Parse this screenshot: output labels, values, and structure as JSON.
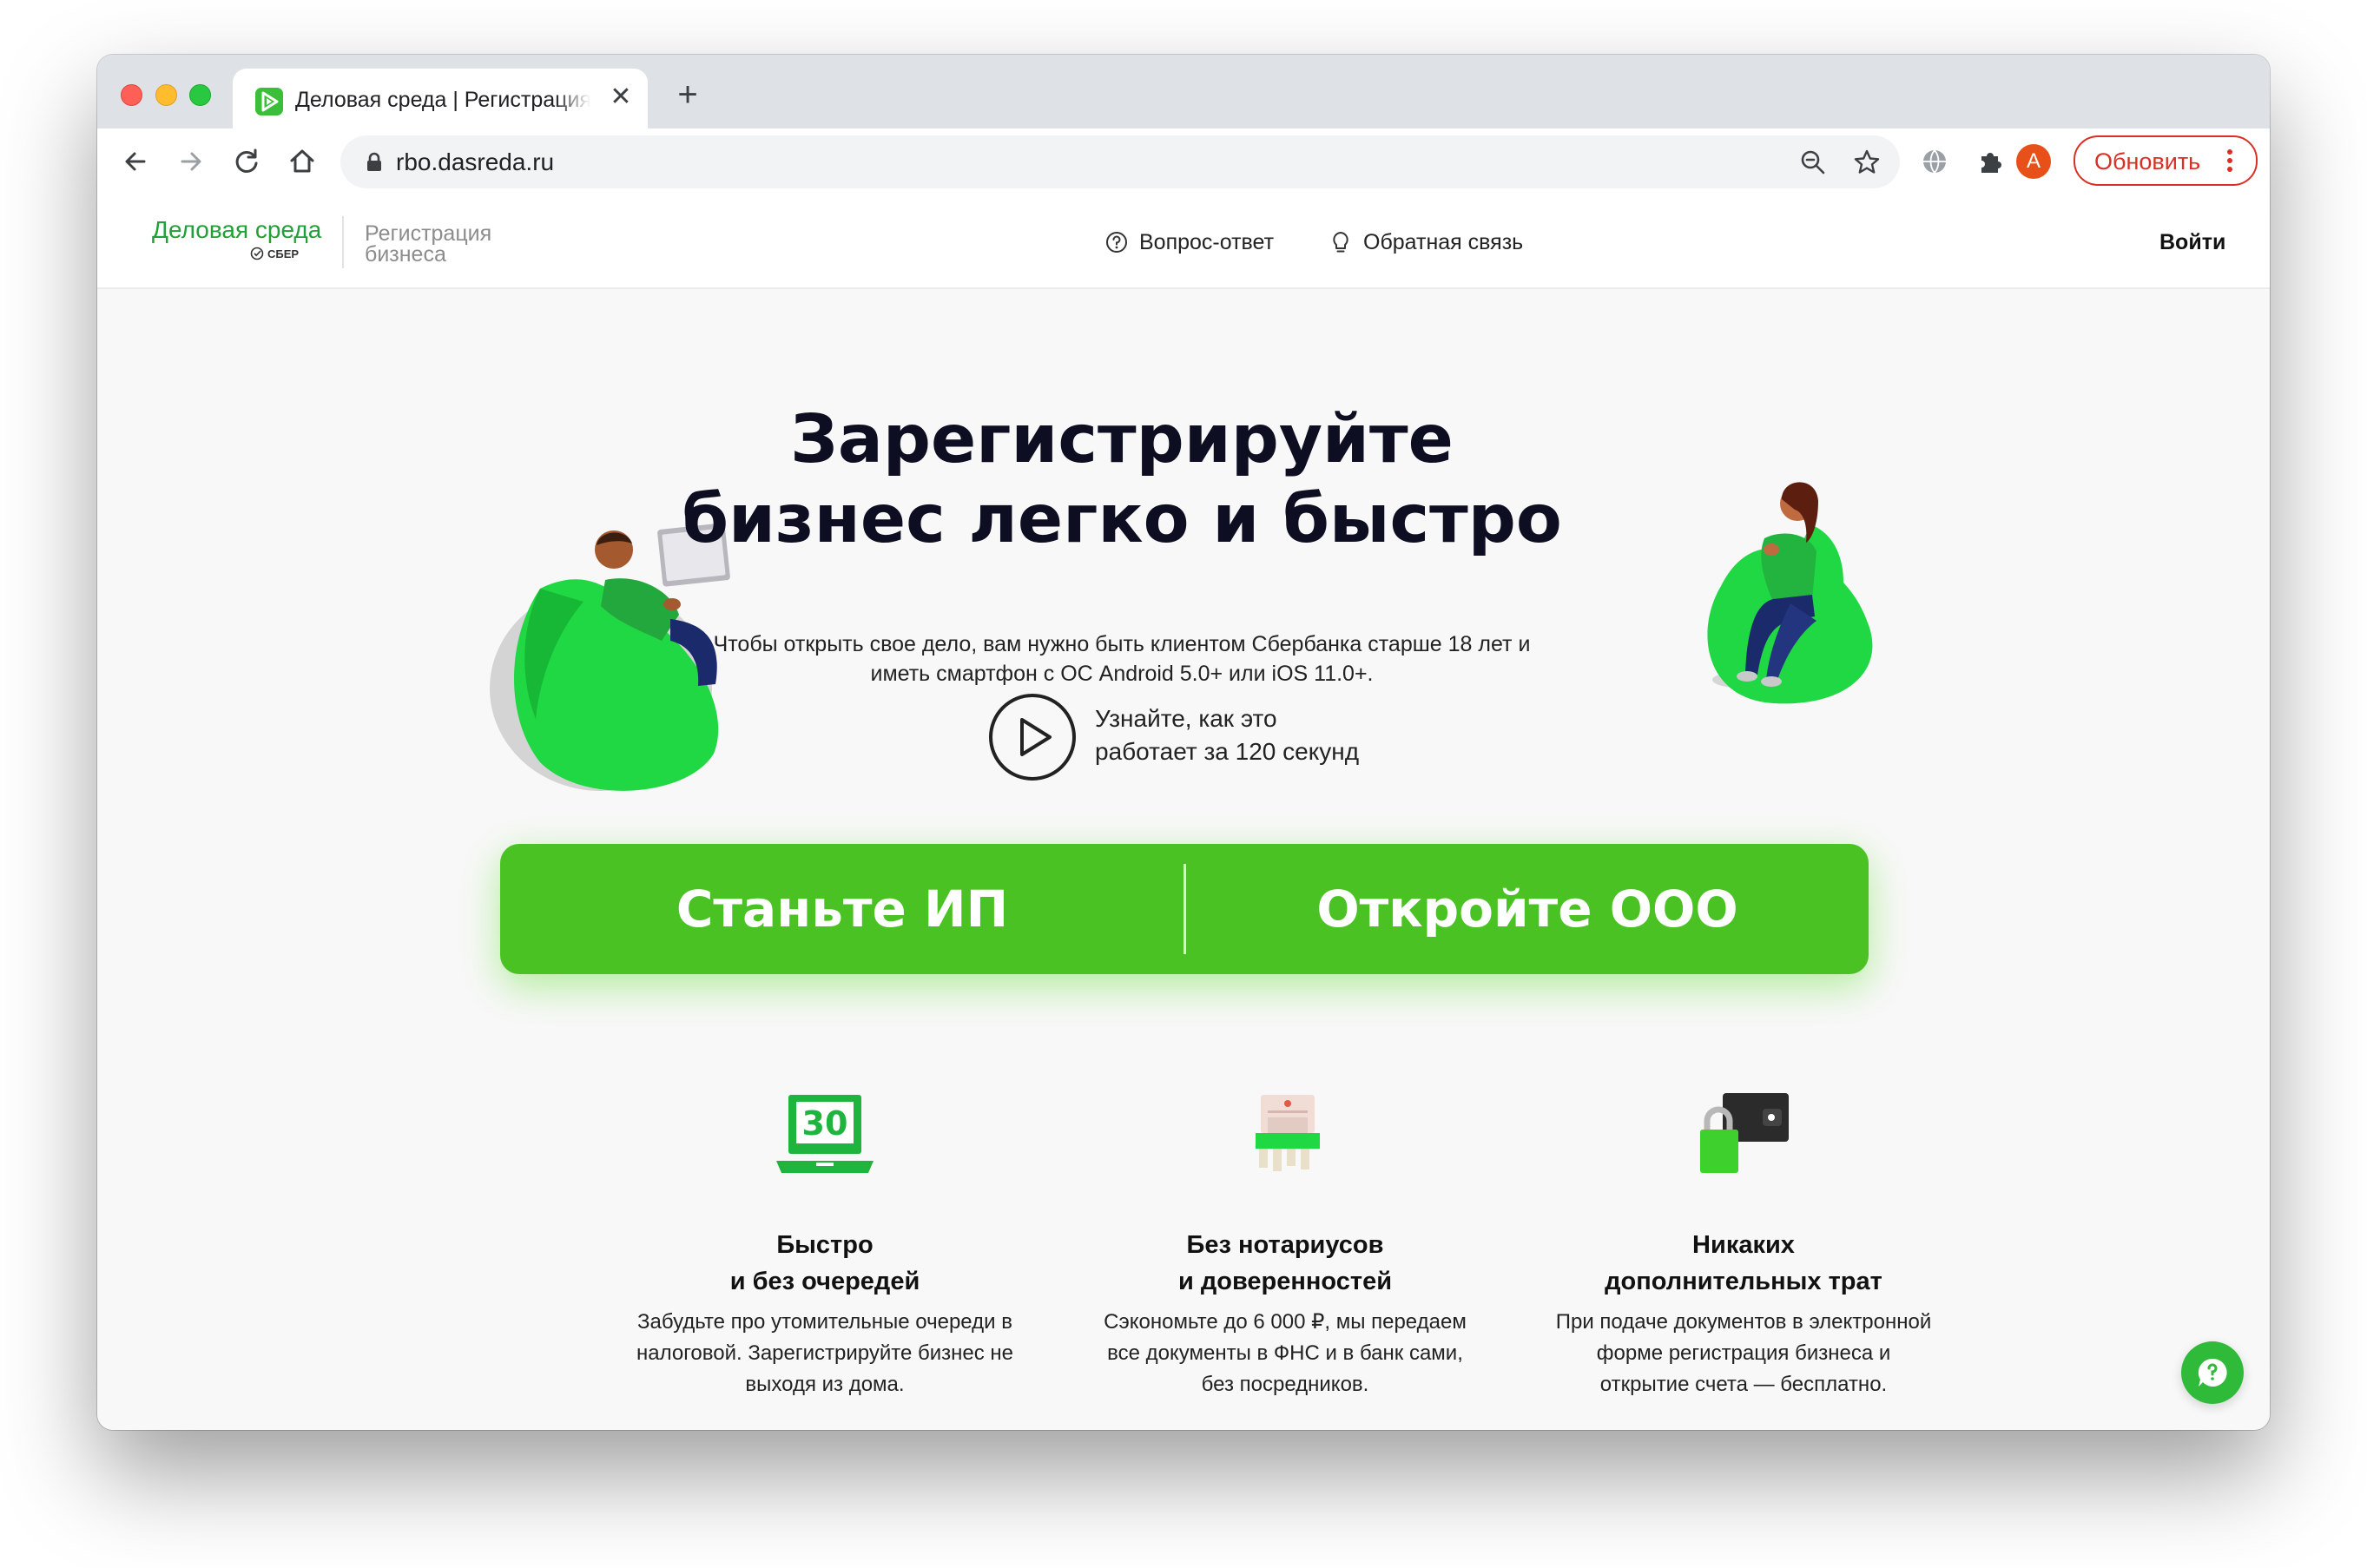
{
  "browser": {
    "tab_title": "Деловая среда | Регистрация бизнеса",
    "new_tab_symbol": "+",
    "close_symbol": "✕",
    "url": "rbo.dasreda.ru",
    "profile_initial": "A",
    "update_label": "Обновить"
  },
  "site": {
    "logo": {
      "name": "Деловая среда",
      "brand": "СБЕР",
      "subtitle_line1": "Регистрация",
      "subtitle_line2": "бизнеса"
    },
    "nav": {
      "faq": "Вопрос-ответ",
      "feedback": "Обратная связь",
      "login": "Войти"
    },
    "hero": {
      "title_line1": "Зарегистрируйте",
      "title_line2": "бизнес легко и быстро",
      "subtitle_line1": "Чтобы открыть свое дело, вам нужно быть клиентом Сбербанка старше 18 лет и",
      "subtitle_line2": "иметь смартфон с ОС Android 5.0+ или iOS 11.0+.",
      "video_line1": "Узнайте, как это",
      "video_line2": "работает за 120 секунд"
    },
    "cta": {
      "ip": "Станьте ИП",
      "ooo": "Откройте ООО"
    },
    "features": [
      {
        "icon": "laptop-30-icon",
        "icon_text": "30",
        "title_line1": "Быстро",
        "title_line2": "и без очередей",
        "desc_line1": "Забудьте про утомительные очереди в",
        "desc_line2": "налоговой. Зарегистрируйте бизнес не",
        "desc_line3": "выходя из дома."
      },
      {
        "icon": "documents-icon",
        "title_line1": "Без нотариусов",
        "title_line2": "и доверенностей",
        "desc_line1": "Сэкономьте до 6 000 ₽, мы передаем",
        "desc_line2": "все документы в ФНС и в банк сами,",
        "desc_line3": "без посредников."
      },
      {
        "icon": "wallet-lock-icon",
        "title_line1": "Никаких",
        "title_line2": "дополнительных трат",
        "desc_line1": "При подаче документов в электронной",
        "desc_line2": "форме регистрация бизнеса и",
        "desc_line3": "открытие счета — бесплатно."
      }
    ]
  },
  "colors": {
    "brand_green": "#4bc224",
    "logo_green": "#21a038",
    "update_red": "#d93025",
    "title_dark": "#0e0e22"
  }
}
